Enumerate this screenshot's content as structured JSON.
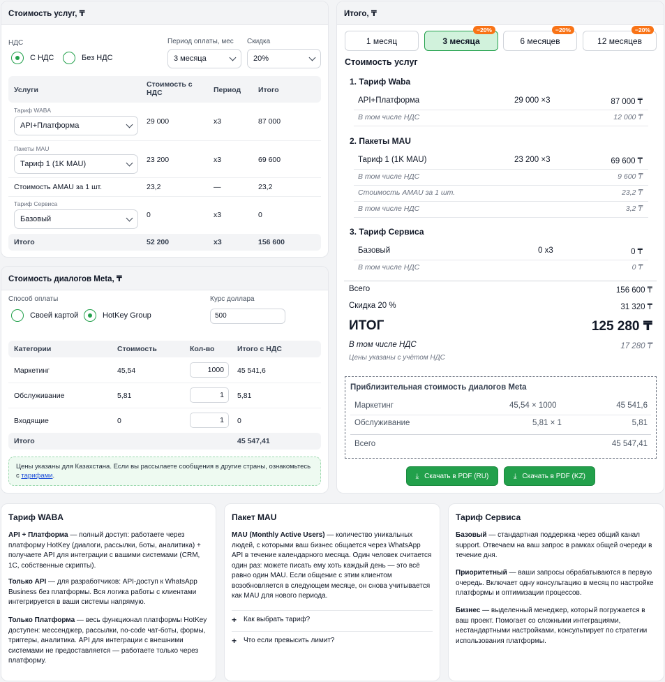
{
  "services": {
    "title": "Стоимость услуг, ₸",
    "nds_label": "НДС",
    "nds_options": [
      "С НДС",
      "Без НДС"
    ],
    "period_label": "Период оплаты, мес",
    "period_value": "3 месяца",
    "discount_label": "Скидка",
    "discount_value": "20%",
    "headers": [
      "Услуги",
      "Стоимость с НДС",
      "Период",
      "Итого"
    ],
    "waba_label": "Тариф WABA",
    "waba_value": "API+Платформа",
    "waba_cost": "29 000",
    "waba_period": "x3",
    "waba_total": "87 000",
    "mau_label": "Пакеты MAU",
    "mau_value": "Тариф 1 (1K MAU)",
    "mau_cost": "23 200",
    "mau_period": "x3",
    "mau_total": "69 600",
    "amau_label": "Стоимость AMAU за 1 шт.",
    "amau_cost": "23,2",
    "amau_period": "—",
    "amau_total": "23,2",
    "service_label": "Тариф Сервиса",
    "service_value": "Базовый",
    "service_cost": "0",
    "service_period": "x3",
    "service_total": "0",
    "total_label": "Итого",
    "total_cost": "52 200",
    "total_period": "x3",
    "total_total": "156 600"
  },
  "meta": {
    "title": "Стоимость диалогов Meta, ₸",
    "pay_label": "Способ оплаты",
    "pay_options": [
      "Своей картой",
      "HotKey Group"
    ],
    "rate_label": "Курс доллара",
    "rate_value": "500",
    "headers": [
      "Категории",
      "Стоимость",
      "Кол-во",
      "Итого с НДС"
    ],
    "rows": [
      {
        "name": "Маркетинг",
        "cost": "45,54",
        "qty": "1000",
        "total": "45 541,6"
      },
      {
        "name": "Обслуживание",
        "cost": "5,81",
        "qty": "1",
        "total": "5,81"
      },
      {
        "name": "Входящие",
        "cost": "0",
        "qty": "1",
        "total": "0"
      }
    ],
    "total_label": "Итого",
    "total_value": "45 547,41",
    "note_text": "Цены указаны для Казахстана. Если вы рассылаете сообщения в другие страны, ознакомьтесь с ",
    "note_link": "тарифами",
    "note_end": "."
  },
  "summary": {
    "title": "Итого, ₸",
    "tabs": [
      {
        "label": "1 месяц",
        "badge": ""
      },
      {
        "label": "3 месяца",
        "badge": "−20%"
      },
      {
        "label": "6 месяцев",
        "badge": "−20%"
      },
      {
        "label": "12 месяцев",
        "badge": "−20%"
      }
    ],
    "section_title": "Стоимость услуг",
    "g1_title": "1. Тариф Waba",
    "g1_name": "API+Платформа",
    "g1_calc": "29 000 ×3",
    "g1_total": "87 000 ₸",
    "g1_vat_label": "В том числе НДС",
    "g1_vat": "12 000 ₸",
    "g2_title": "2. Пакеты MAU",
    "g2_name": "Тариф 1 (1K MAU)",
    "g2_calc": "23 200 ×3",
    "g2_total": "69 600 ₸",
    "g2_vat_label": "В том числе НДС",
    "g2_vat": "9 600 ₸",
    "g2_amau_label": "Стоимость AMAU за 1 шт.",
    "g2_amau": "23,2 ₸",
    "g2_vat2_label": "В том числе НДС",
    "g2_vat2": "3,2 ₸",
    "g3_title": "3. Тариф Сервиса",
    "g3_name": "Базовый",
    "g3_calc": "0 x3",
    "g3_total": "0 ₸",
    "g3_vat_label": "В том числе НДС",
    "g3_vat": "0 ₸",
    "all_label": "Всего",
    "all_value": "156 600 ₸",
    "discount_label": "Скидка 20 %",
    "discount_value": "31 320 ₸",
    "final_label": "ИТОГ",
    "final_value": "125 280 ₸",
    "final_vat_label": "В том числе НДС",
    "final_vat": "17 280 ₸",
    "prices_note": "Цены указаны с учётом НДС",
    "meta_title": "Приблизительная стоимость диалогов Meta",
    "meta_rows": [
      {
        "name": "Маркетинг",
        "calc": "45,54 × 1000",
        "value": "45 541,6"
      },
      {
        "name": "Обслуживание",
        "calc": "5,81 × 1",
        "value": "5,81"
      }
    ],
    "meta_total_label": "Всего",
    "meta_total": "45 547,41",
    "pdf_ru": "Скачать в PDF (RU)",
    "pdf_kz": "Скачать в PDF (KZ)"
  },
  "info_waba": {
    "title": "Тариф WABA",
    "p1_bold": "API + Платформа",
    "p1_text": " — полный доступ: работаете через платформу HotKey (диалоги, рассылки, боты, аналитика) + получаете API для интеграции с вашими системами (CRM, 1С, собственные скрипты).",
    "p2_bold": "Только API",
    "p2_text": " — для разработчиков: API-доступ к WhatsApp Business без платформы. Вся логика работы с клиентами интегрируется в ваши системы напрямую.",
    "p3_bold": "Только Платформа",
    "p3_text": " — весь функционал платформы HotKey доступен: мессенджер, рассылки, no-code чат-боты, формы, триггеры, аналитика. API для интеграции с внешними системами не предоставляется — работаете только через платформу."
  },
  "info_mau": {
    "title": "Пакет MAU",
    "p1_bold": "MAU (Monthly Active Users)",
    "p1_text": " — количество уникальных людей, с которыми ваш бизнес общается через WhatsApp API в течение календарного месяца. Один человек считается один раз: можете писать ему хоть каждый день — это всё равно один MAU. Если общение с этим клиентом возобновляется в следующем месяце, он снова учитывается как MAU для нового периода.",
    "faq": [
      "Как выбрать тариф?",
      "Что если превысить лимит?"
    ]
  },
  "info_service": {
    "title": "Тариф Сервиса",
    "p1_bold": "Базовый",
    "p1_text": " — стандартная поддержка через общий канал support. Отвечаем на ваш запрос в рамках общей очереди в течение дня.",
    "p2_bold": "Приоритетный",
    "p2_text": " — ваши запросы обрабатываются в первую очередь. Включает одну консультацию в месяц по настройке платформы и оптимизации процессов.",
    "p3_bold": "Бизнес",
    "p3_text": " — выделенный менеджер, который погружается в ваш проект. Помогает со сложными интеграциями, нестандартными настройками, консультирует по стратегии использования платформы."
  },
  "colors": {
    "accent": "#22a04b",
    "badge": "#f97316",
    "tab_active": "#d1f2dc"
  }
}
